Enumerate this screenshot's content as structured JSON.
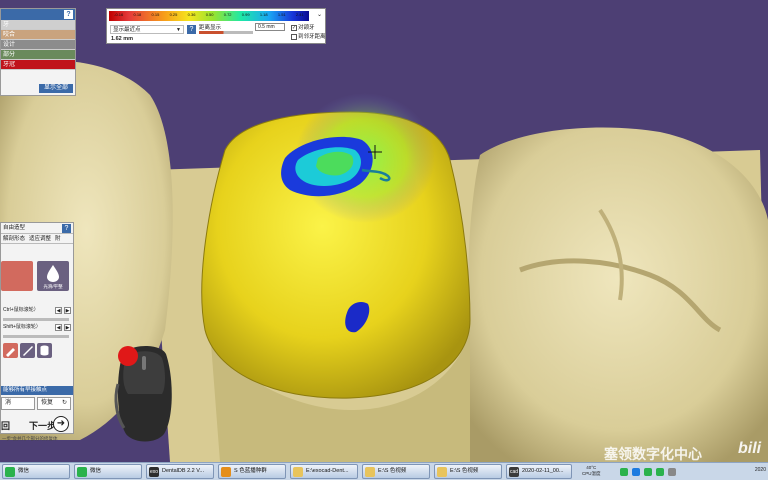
{
  "layers_panel": {
    "help_label": "?",
    "rows": [
      {
        "label": "牙",
        "color": "#cfcfcf"
      },
      {
        "label": "咬合",
        "color": "#c9a37e"
      },
      {
        "label": "设计",
        "color": "#8c8c8c"
      },
      {
        "label": "部分",
        "color": "#6a8a5c"
      },
      {
        "label": "牙冠",
        "color": "#c0131b"
      }
    ],
    "show_all_label": "显示全部"
  },
  "distance_panel": {
    "colorbar_ticks": [
      "-0.16",
      "0.18",
      "0.15",
      "0.25",
      "0.36",
      "0.50",
      "0.72",
      "0.99",
      "1.18",
      "1.51",
      "2.41"
    ],
    "min_distance_select": "显示最近点",
    "min_distance_value": "1.62 mm",
    "help_label": "?",
    "distance_label": "距离显示",
    "distance_input": "0.5 mm",
    "checkbox_antagonist": {
      "label": "对颌牙",
      "checked": true
    },
    "checkbox_adjacent": {
      "label": "到邻牙距离",
      "checked": false
    },
    "dropdown_caret": "⌄"
  },
  "tool_panel": {
    "header": "自由造型",
    "help_label": "?",
    "tabs": [
      "解剖形态",
      "适应调整",
      "附"
    ],
    "tool_left_label": "",
    "tool_right_label": "光滑/平整",
    "slider1_label": "Ctrl+鼠标滚轮）",
    "slider2_label": "Shift+鼠标滚轮）",
    "apply_all_label": "能够所有早接触点",
    "undo_label": "消",
    "redo_label": "恢复",
    "back_label": "回",
    "next_label": "下一步",
    "hint": "一步”会并几个部分的修复体"
  },
  "watermark": "塞领数字化中心",
  "watermark_logo": "bili",
  "taskbar": {
    "tasks": [
      {
        "label": "微信",
        "icon_color": "#2bb24c"
      },
      {
        "label": "微信",
        "icon_color": "#2bb24c"
      },
      {
        "label": "DentalDB 2.2 V...",
        "icon_color": "#2d2d2d",
        "icon_text": "exo"
      },
      {
        "label": "S 色蓝播种群",
        "icon_color": "#e58e1a"
      },
      {
        "label": "E:\\exocad-Dent...",
        "icon_color": "#e8c45c"
      },
      {
        "label": "E:\\S 色视频",
        "icon_color": "#e8c45c"
      },
      {
        "label": "E:\\S 色视频",
        "icon_color": "#e8c45c"
      },
      {
        "label": "2020-02-11_00...",
        "icon_color": "#3a3a3a",
        "icon_text": "cad"
      }
    ],
    "cpu_temp_value": "40°C",
    "cpu_temp_label": "CPU温度",
    "clock": "2020"
  }
}
